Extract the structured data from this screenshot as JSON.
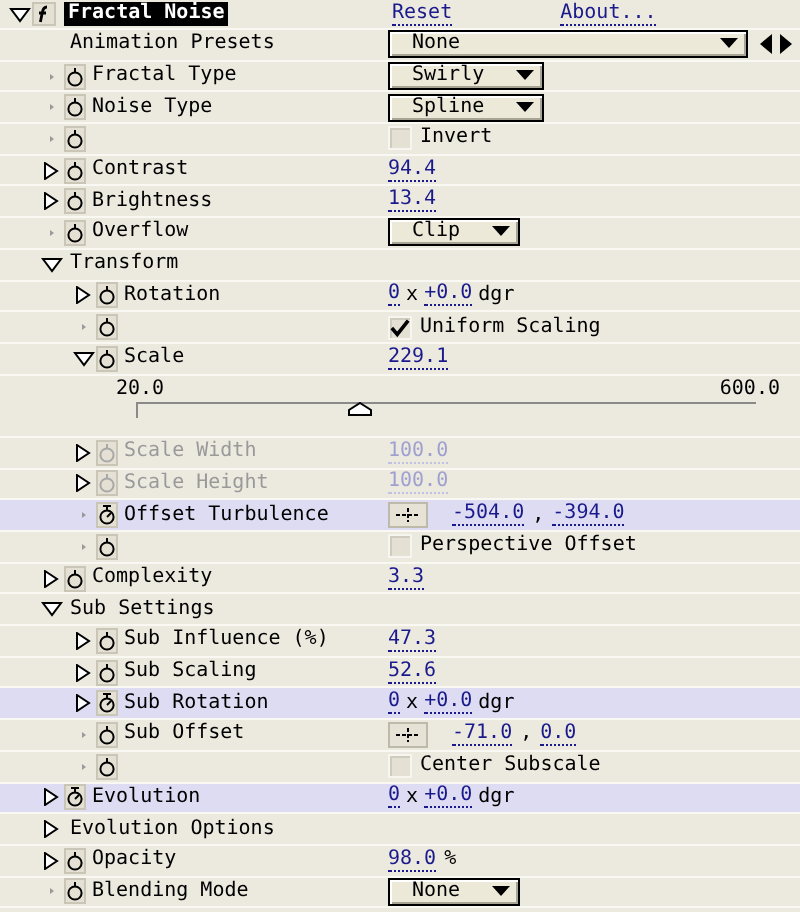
{
  "effect": {
    "name": "Fractal Noise",
    "selected": true,
    "expanded": true,
    "links": [
      "Reset",
      "About..."
    ],
    "properties": [
      {
        "kind": "presets",
        "name": "Animation Presets",
        "value": "None"
      },
      {
        "kind": "dropdown",
        "name": "Fractal Type",
        "expandable": false,
        "disabled": false,
        "animated": false,
        "value": "Swirly"
      },
      {
        "kind": "dropdown",
        "name": "Noise Type",
        "expandable": false,
        "disabled": false,
        "animated": false,
        "value": "Spline"
      },
      {
        "kind": "checkbox",
        "expandable": false,
        "disabled": false,
        "animated": false,
        "label": "Invert",
        "checked": false
      },
      {
        "kind": "number",
        "name": "Contrast",
        "expandable": true,
        "expanded": false,
        "disabled": false,
        "animated": false,
        "value": "94.4"
      },
      {
        "kind": "number",
        "name": "Brightness",
        "expandable": true,
        "expanded": false,
        "disabled": false,
        "animated": false,
        "value": "13.4"
      },
      {
        "kind": "dropdown",
        "name": "Overflow",
        "expandable": false,
        "disabled": false,
        "animated": false,
        "value": "Clip"
      },
      {
        "kind": "group",
        "name": "Transform",
        "expanded": true,
        "children": [
          {
            "kind": "angle",
            "name": "Rotation",
            "expandable": true,
            "expanded": false,
            "disabled": false,
            "animated": false,
            "turns": "0",
            "sep": "x",
            "degrees": "+0.0",
            "unit": "dgr"
          },
          {
            "kind": "checkbox",
            "expandable": false,
            "disabled": false,
            "animated": false,
            "label": "Uniform Scaling",
            "checked": true
          },
          {
            "kind": "number",
            "name": "Scale",
            "expandable": true,
            "expanded": true,
            "disabled": false,
            "animated": false,
            "value": "229.1",
            "slider": {
              "min": "20.0",
              "max": "600.0",
              "level": 0.36
            }
          },
          {
            "kind": "number",
            "name": "Scale Width",
            "expandable": true,
            "expanded": false,
            "disabled": true,
            "animated": false,
            "value": "100.0"
          },
          {
            "kind": "number",
            "name": "Scale Height",
            "expandable": true,
            "expanded": false,
            "disabled": true,
            "animated": false,
            "value": "100.0"
          },
          {
            "kind": "point",
            "name": "Offset Turbulence",
            "expandable": false,
            "disabled": false,
            "animated": true,
            "values": [
              "-504.0",
              "-394.0"
            ],
            "separator": ","
          },
          {
            "kind": "checkbox",
            "expandable": false,
            "disabled": false,
            "animated": false,
            "label": "Perspective Offset",
            "checked": false
          }
        ]
      },
      {
        "kind": "number",
        "name": "Complexity",
        "expandable": true,
        "expanded": false,
        "disabled": false,
        "animated": false,
        "value": "3.3"
      },
      {
        "kind": "group",
        "name": "Sub Settings",
        "expanded": true,
        "children": [
          {
            "kind": "number",
            "name": "Sub Influence (%)",
            "expandable": true,
            "expanded": false,
            "disabled": false,
            "animated": false,
            "value": "47.3"
          },
          {
            "kind": "number",
            "name": "Sub Scaling",
            "expandable": true,
            "expanded": false,
            "disabled": false,
            "animated": false,
            "value": "52.6"
          },
          {
            "kind": "angle",
            "name": "Sub Rotation",
            "expandable": true,
            "expanded": false,
            "disabled": false,
            "animated": true,
            "turns": "0",
            "sep": "x",
            "degrees": "+0.0",
            "unit": "dgr"
          },
          {
            "kind": "point",
            "name": "Sub Offset",
            "expandable": false,
            "disabled": false,
            "animated": false,
            "values": [
              "-71.0",
              "0.0"
            ],
            "separator": ","
          },
          {
            "kind": "checkbox",
            "expandable": false,
            "disabled": false,
            "animated": false,
            "label": "Center Subscale",
            "checked": false
          }
        ]
      },
      {
        "kind": "angle",
        "name": "Evolution",
        "expandable": true,
        "expanded": false,
        "disabled": false,
        "animated": true,
        "turns": "0",
        "sep": "x",
        "degrees": "+0.0",
        "unit": "dgr"
      },
      {
        "kind": "group",
        "name": "Evolution Options",
        "expanded": false
      },
      {
        "kind": "number",
        "name": "Opacity",
        "expandable": true,
        "expanded": false,
        "disabled": false,
        "animated": false,
        "value": "98.0",
        "unit": "%"
      },
      {
        "kind": "dropdown",
        "name": "Blending Mode",
        "expandable": false,
        "disabled": false,
        "animated": false,
        "value": "None"
      }
    ]
  }
}
